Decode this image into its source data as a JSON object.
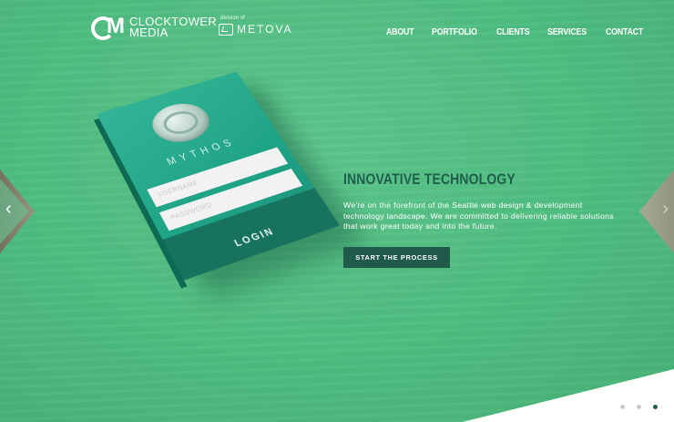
{
  "brand": {
    "logo_mark": "M",
    "name_line1": "CLOCKTOWER",
    "name_line2": "MEDIA",
    "division_label": "division of",
    "partner_name": "METOVA"
  },
  "nav": {
    "items": [
      "ABOUT",
      "PORTFOLIO",
      "CLIENTS",
      "SERVICES",
      "CONTACT"
    ]
  },
  "phone": {
    "app_name": "MYTHOS",
    "username_placeholder": "USERNAME",
    "password_placeholder": "PASSWORD",
    "login_label": "LOGIN"
  },
  "hero": {
    "headline": "INNOVATIVE TECHNOLOGY",
    "description": "We're on the forefront of the Seattle web design & development technology landscape. We are committed to delivering reliable solutions that work great today and into the future.",
    "cta_label": "START THE PROCESS"
  },
  "slider": {
    "prev_icon": "chevron-left-icon",
    "next_icon": "chevron-right-icon",
    "dot_count": 3,
    "active_dot": 3
  },
  "colors": {
    "background": "#4fbf82",
    "headline": "#1f5e4b",
    "cta": "#1f5a4a"
  }
}
